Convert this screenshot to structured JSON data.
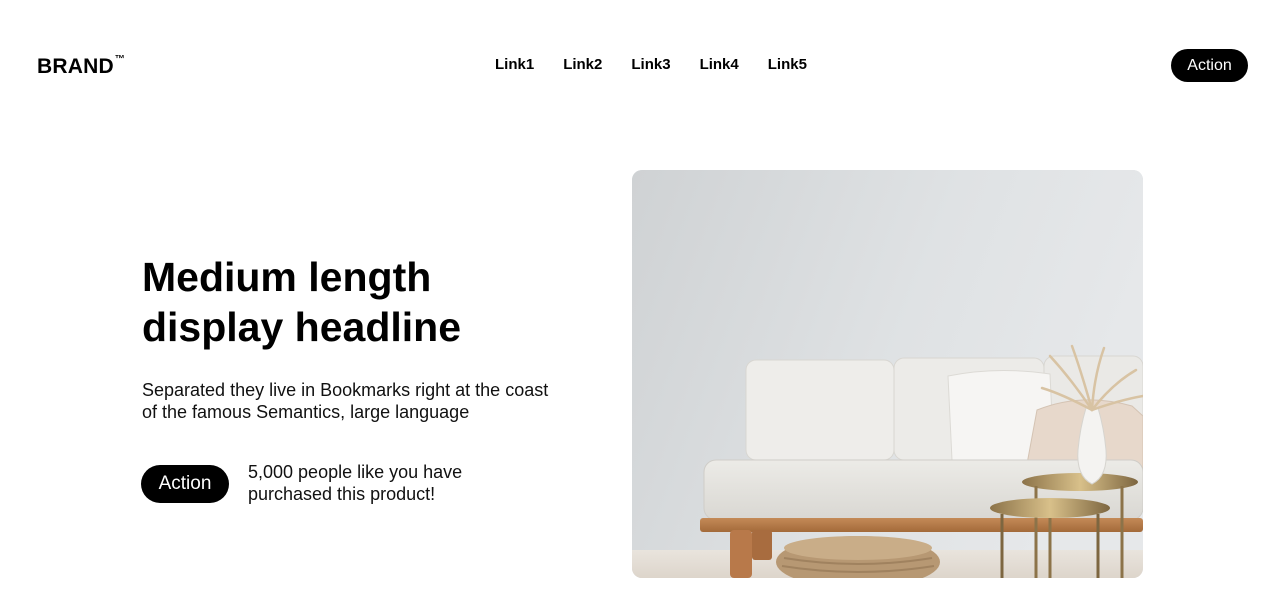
{
  "header": {
    "brand": "BRAND",
    "brand_mark": "™",
    "nav": [
      "Link1",
      "Link2",
      "Link3",
      "Link4",
      "Link5"
    ],
    "action_label": "Action"
  },
  "hero": {
    "headline": "Medium length display headline",
    "subtext": "Separated they live in Bookmarks right at the coast of the famous Semantics, large language",
    "action_label": "Action",
    "social_proof": "5,000 people like you have purchased this product!",
    "image": "living-room-sofa-photo"
  },
  "colors": {
    "background": "#ffffff",
    "text": "#000000",
    "button_bg": "#000000",
    "button_text": "#ffffff"
  }
}
